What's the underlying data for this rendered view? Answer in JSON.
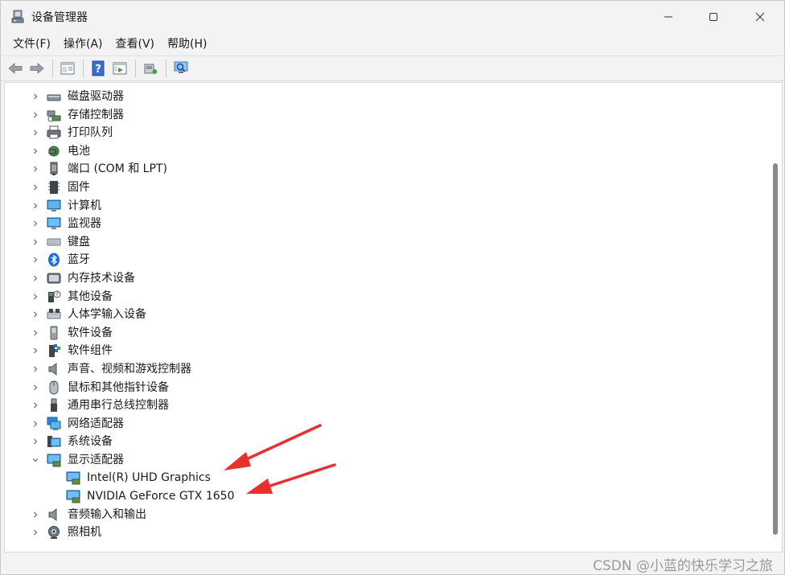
{
  "window": {
    "title": "设备管理器",
    "app_icon": "device-manager-icon",
    "controls": [
      "minimize-icon",
      "maximize-icon",
      "close-icon"
    ]
  },
  "menu": [
    {
      "label": "文件(F)"
    },
    {
      "label": "操作(A)"
    },
    {
      "label": "查看(V)"
    },
    {
      "label": "帮助(H)"
    }
  ],
  "toolbar": [
    "back-arrow-icon",
    "forward-arrow-icon",
    "properties-icon",
    "help-icon",
    "show-hidden-icon",
    "update-driver-icon",
    "scan-hardware-icon"
  ],
  "tree": [
    {
      "label": "磁盘驱动器",
      "icon": "disk-drive-icon",
      "expanded": false
    },
    {
      "label": "存储控制器",
      "icon": "storage-controller-icon",
      "expanded": false
    },
    {
      "label": "打印队列",
      "icon": "printer-icon",
      "expanded": false
    },
    {
      "label": "电池",
      "icon": "battery-icon",
      "expanded": false
    },
    {
      "label": "端口 (COM 和 LPT)",
      "icon": "port-icon",
      "expanded": false
    },
    {
      "label": "固件",
      "icon": "firmware-icon",
      "expanded": false
    },
    {
      "label": "计算机",
      "icon": "computer-icon",
      "expanded": false
    },
    {
      "label": "监视器",
      "icon": "monitor-icon",
      "expanded": false
    },
    {
      "label": "键盘",
      "icon": "keyboard-icon",
      "expanded": false
    },
    {
      "label": "蓝牙",
      "icon": "bluetooth-icon",
      "expanded": false
    },
    {
      "label": "内存技术设备",
      "icon": "memory-device-icon",
      "expanded": false
    },
    {
      "label": "其他设备",
      "icon": "unknown-device-icon",
      "expanded": false
    },
    {
      "label": "人体学输入设备",
      "icon": "hid-icon",
      "expanded": false
    },
    {
      "label": "软件设备",
      "icon": "software-device-icon",
      "expanded": false
    },
    {
      "label": "软件组件",
      "icon": "software-component-icon",
      "expanded": false
    },
    {
      "label": "声音、视频和游戏控制器",
      "icon": "speaker-icon",
      "expanded": false
    },
    {
      "label": "鼠标和其他指针设备",
      "icon": "mouse-icon",
      "expanded": false
    },
    {
      "label": "通用串行总线控制器",
      "icon": "usb-icon",
      "expanded": false
    },
    {
      "label": "网络适配器",
      "icon": "network-adapter-icon",
      "expanded": false
    },
    {
      "label": "系统设备",
      "icon": "system-device-icon",
      "expanded": false
    },
    {
      "label": "显示适配器",
      "icon": "display-adapter-icon",
      "expanded": true,
      "children": [
        {
          "label": "Intel(R) UHD Graphics",
          "icon": "display-adapter-icon"
        },
        {
          "label": "NVIDIA GeForce GTX 1650",
          "icon": "display-adapter-icon"
        }
      ]
    },
    {
      "label": "音频输入和输出",
      "icon": "speaker-icon",
      "expanded": false
    },
    {
      "label": "照相机",
      "icon": "camera-icon",
      "expanded": false
    }
  ],
  "watermark": "CSDN @小蓝的快乐学习之旅",
  "colors": {
    "arrow": "#e8312f",
    "accent": "#2b78c8"
  }
}
